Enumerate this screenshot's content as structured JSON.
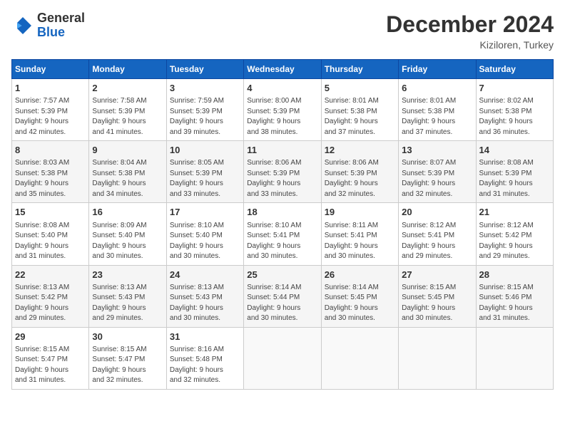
{
  "header": {
    "logo_general": "General",
    "logo_blue": "Blue",
    "month": "December 2024",
    "location": "Kiziloren, Turkey"
  },
  "weekdays": [
    "Sunday",
    "Monday",
    "Tuesday",
    "Wednesday",
    "Thursday",
    "Friday",
    "Saturday"
  ],
  "weeks": [
    [
      {
        "day": "1",
        "detail": "Sunrise: 7:57 AM\nSunset: 5:39 PM\nDaylight: 9 hours\nand 42 minutes."
      },
      {
        "day": "2",
        "detail": "Sunrise: 7:58 AM\nSunset: 5:39 PM\nDaylight: 9 hours\nand 41 minutes."
      },
      {
        "day": "3",
        "detail": "Sunrise: 7:59 AM\nSunset: 5:39 PM\nDaylight: 9 hours\nand 39 minutes."
      },
      {
        "day": "4",
        "detail": "Sunrise: 8:00 AM\nSunset: 5:39 PM\nDaylight: 9 hours\nand 38 minutes."
      },
      {
        "day": "5",
        "detail": "Sunrise: 8:01 AM\nSunset: 5:38 PM\nDaylight: 9 hours\nand 37 minutes."
      },
      {
        "day": "6",
        "detail": "Sunrise: 8:01 AM\nSunset: 5:38 PM\nDaylight: 9 hours\nand 37 minutes."
      },
      {
        "day": "7",
        "detail": "Sunrise: 8:02 AM\nSunset: 5:38 PM\nDaylight: 9 hours\nand 36 minutes."
      }
    ],
    [
      {
        "day": "8",
        "detail": "Sunrise: 8:03 AM\nSunset: 5:38 PM\nDaylight: 9 hours\nand 35 minutes."
      },
      {
        "day": "9",
        "detail": "Sunrise: 8:04 AM\nSunset: 5:38 PM\nDaylight: 9 hours\nand 34 minutes."
      },
      {
        "day": "10",
        "detail": "Sunrise: 8:05 AM\nSunset: 5:39 PM\nDaylight: 9 hours\nand 33 minutes."
      },
      {
        "day": "11",
        "detail": "Sunrise: 8:06 AM\nSunset: 5:39 PM\nDaylight: 9 hours\nand 33 minutes."
      },
      {
        "day": "12",
        "detail": "Sunrise: 8:06 AM\nSunset: 5:39 PM\nDaylight: 9 hours\nand 32 minutes."
      },
      {
        "day": "13",
        "detail": "Sunrise: 8:07 AM\nSunset: 5:39 PM\nDaylight: 9 hours\nand 32 minutes."
      },
      {
        "day": "14",
        "detail": "Sunrise: 8:08 AM\nSunset: 5:39 PM\nDaylight: 9 hours\nand 31 minutes."
      }
    ],
    [
      {
        "day": "15",
        "detail": "Sunrise: 8:08 AM\nSunset: 5:40 PM\nDaylight: 9 hours\nand 31 minutes."
      },
      {
        "day": "16",
        "detail": "Sunrise: 8:09 AM\nSunset: 5:40 PM\nDaylight: 9 hours\nand 30 minutes."
      },
      {
        "day": "17",
        "detail": "Sunrise: 8:10 AM\nSunset: 5:40 PM\nDaylight: 9 hours\nand 30 minutes."
      },
      {
        "day": "18",
        "detail": "Sunrise: 8:10 AM\nSunset: 5:41 PM\nDaylight: 9 hours\nand 30 minutes."
      },
      {
        "day": "19",
        "detail": "Sunrise: 8:11 AM\nSunset: 5:41 PM\nDaylight: 9 hours\nand 30 minutes."
      },
      {
        "day": "20",
        "detail": "Sunrise: 8:12 AM\nSunset: 5:41 PM\nDaylight: 9 hours\nand 29 minutes."
      },
      {
        "day": "21",
        "detail": "Sunrise: 8:12 AM\nSunset: 5:42 PM\nDaylight: 9 hours\nand 29 minutes."
      }
    ],
    [
      {
        "day": "22",
        "detail": "Sunrise: 8:13 AM\nSunset: 5:42 PM\nDaylight: 9 hours\nand 29 minutes."
      },
      {
        "day": "23",
        "detail": "Sunrise: 8:13 AM\nSunset: 5:43 PM\nDaylight: 9 hours\nand 29 minutes."
      },
      {
        "day": "24",
        "detail": "Sunrise: 8:13 AM\nSunset: 5:43 PM\nDaylight: 9 hours\nand 30 minutes."
      },
      {
        "day": "25",
        "detail": "Sunrise: 8:14 AM\nSunset: 5:44 PM\nDaylight: 9 hours\nand 30 minutes."
      },
      {
        "day": "26",
        "detail": "Sunrise: 8:14 AM\nSunset: 5:45 PM\nDaylight: 9 hours\nand 30 minutes."
      },
      {
        "day": "27",
        "detail": "Sunrise: 8:15 AM\nSunset: 5:45 PM\nDaylight: 9 hours\nand 30 minutes."
      },
      {
        "day": "28",
        "detail": "Sunrise: 8:15 AM\nSunset: 5:46 PM\nDaylight: 9 hours\nand 31 minutes."
      }
    ],
    [
      {
        "day": "29",
        "detail": "Sunrise: 8:15 AM\nSunset: 5:47 PM\nDaylight: 9 hours\nand 31 minutes."
      },
      {
        "day": "30",
        "detail": "Sunrise: 8:15 AM\nSunset: 5:47 PM\nDaylight: 9 hours\nand 32 minutes."
      },
      {
        "day": "31",
        "detail": "Sunrise: 8:16 AM\nSunset: 5:48 PM\nDaylight: 9 hours\nand 32 minutes."
      },
      {
        "day": "",
        "detail": ""
      },
      {
        "day": "",
        "detail": ""
      },
      {
        "day": "",
        "detail": ""
      },
      {
        "day": "",
        "detail": ""
      }
    ]
  ]
}
